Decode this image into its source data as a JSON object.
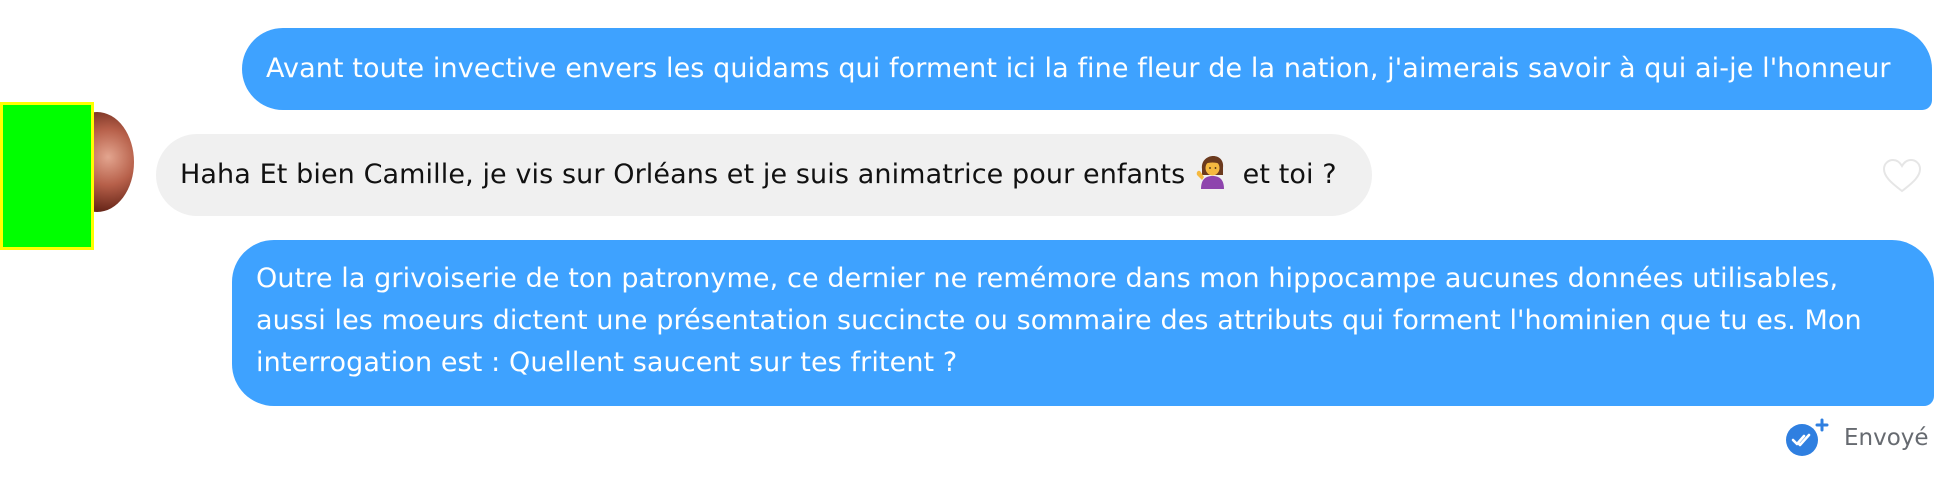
{
  "messages": [
    {
      "id": "msg1",
      "direction": "outgoing",
      "text": "Avant toute invective envers les quidams qui forment ici la fine fleur de la nation, j'aimerais savoir à qui ai-je l'honneur"
    },
    {
      "id": "msg2",
      "direction": "incoming",
      "text_before_emoji": "Haha Et bien Camille, je vis sur Orléans et je suis animatrice pour enfants",
      "emoji": "person-tipping-hand-emoji",
      "text_after_emoji": "et toi ?"
    },
    {
      "id": "msg3",
      "direction": "outgoing",
      "lines": [
        "Outre la grivoiserie de ton patronyme, ce dernier ne remémore dans mon hippocampe aucunes données utilisables,",
        "aussi les moeurs dictent une présentation succincte ou sommaire des attributs qui forment l'hominien que tu es. Mon",
        "interrogation est : Quellent saucent sur tes fritent ?"
      ]
    }
  ],
  "status": {
    "icon": "double-check-plus-icon",
    "label": "Envoyé"
  },
  "icons": {
    "like": "heart-outline-icon",
    "avatar": "contact-avatar"
  },
  "colors": {
    "outgoing_bubble": "#3ea2ff",
    "incoming_bubble": "#f0f0f0",
    "status_icon": "#2f7fe0",
    "redaction_fill": "#00ff00",
    "redaction_border": "#ffff00"
  }
}
